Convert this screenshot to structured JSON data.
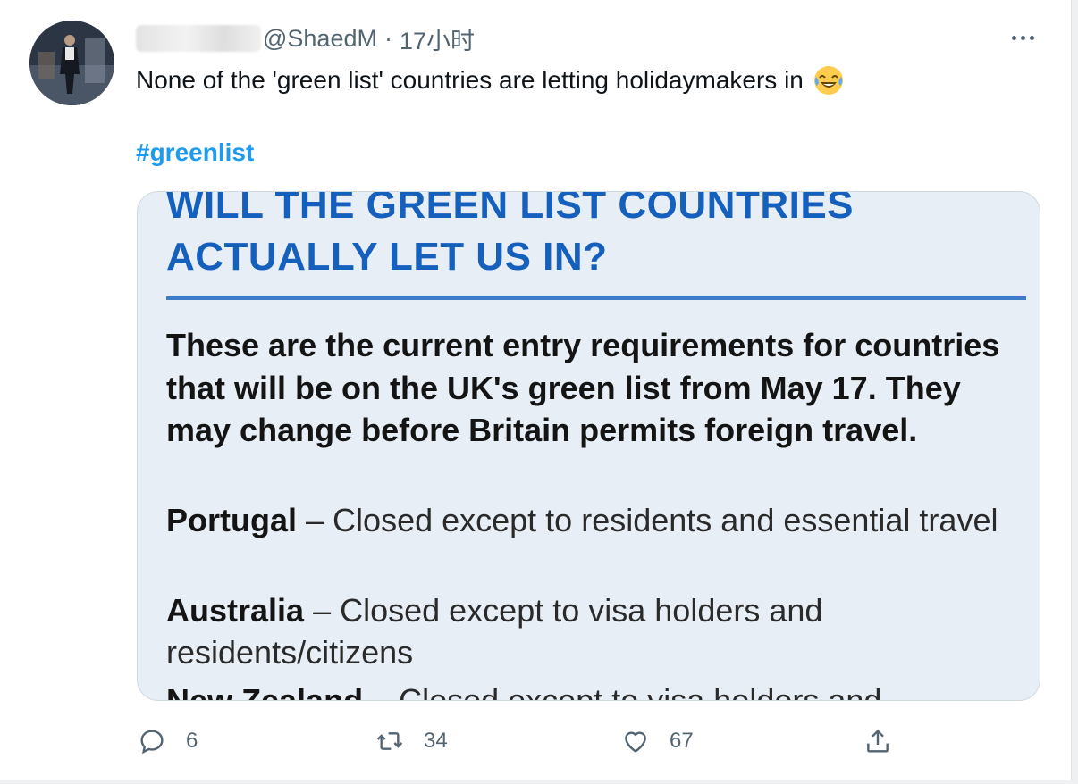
{
  "tweet": {
    "handle": "@ShaedM",
    "separator": "·",
    "time": "17小时",
    "text": "None of the 'green list' countries are letting holidaymakers in",
    "emoji": "face-with-tears-of-joy",
    "hashtag": "#greenlist"
  },
  "media": {
    "headline_line1": "WILL THE GREEN LIST COUNTRIES",
    "headline_line2": "ACTUALLY LET US IN?",
    "intro": "These are the current entry requirements for countries that will be on the UK's green list from May 17. They may change before Britain permits foreign travel.",
    "entries": [
      {
        "country": "Portugal",
        "dash": " – ",
        "status": "Closed except to residents and essential travel"
      },
      {
        "country": "Australia",
        "dash": " – ",
        "status": "Closed except to visa holders and residents/citizens"
      },
      {
        "country": "New Zealand",
        "dash": " – ",
        "status": "Closed except to visa holders and"
      }
    ],
    "colors": {
      "headline": "#1660bd",
      "rule": "#3c7cc8",
      "background": "#e7eef6"
    }
  },
  "actions": {
    "reply_count": "6",
    "retweet_count": "34",
    "like_count": "67"
  },
  "colors": {
    "link": "#1d9bf0",
    "muted": "#536471",
    "text": "#0f1419"
  }
}
